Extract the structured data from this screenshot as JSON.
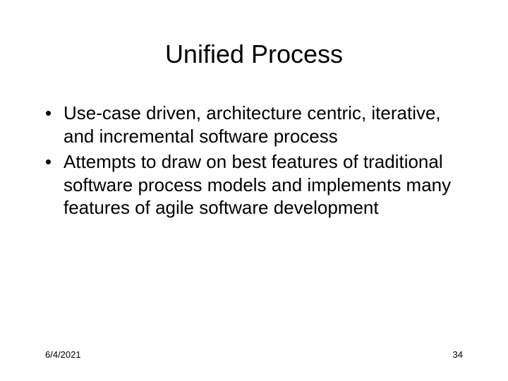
{
  "title": "Unified Process",
  "bullets": [
    "Use-case driven, architecture centric, iterative, and incremental software process",
    "Attempts to draw on best features of traditional software process models and implements many features of agile software development"
  ],
  "footer": {
    "date": "6/4/2021",
    "page": "34"
  }
}
